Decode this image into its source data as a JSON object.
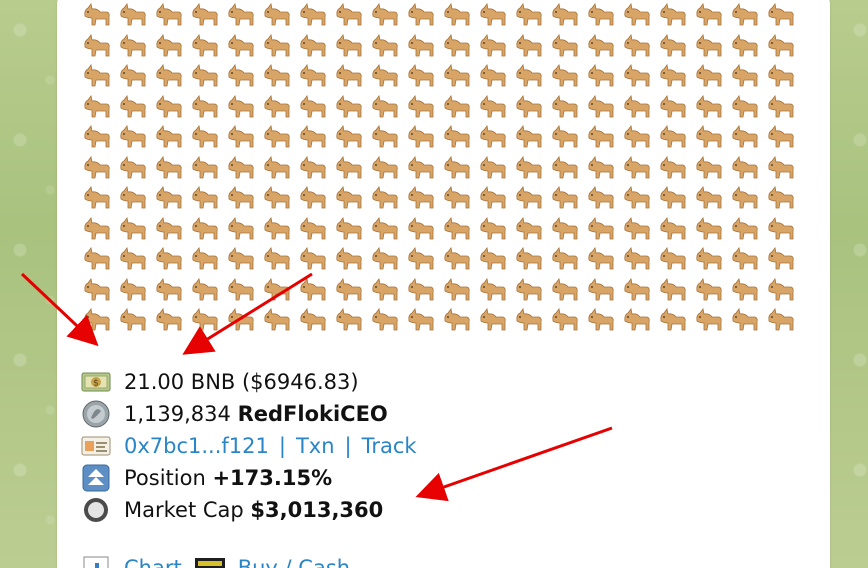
{
  "pattern": {
    "glyph": "🐕",
    "rows": 11,
    "cols": 20
  },
  "post": {
    "bnb_line": "21.00 BNB ($6946.83)",
    "tokens_amount": "1,139,834",
    "token_name": "RedFlokiCEO",
    "wallet_link": "0x7bc1...f121",
    "separator": "|",
    "txn_link": "Txn",
    "track_link": "Track",
    "position_label": "Position",
    "position_value": "+173.15%",
    "mcap_label": "Market Cap",
    "mcap_value": "$3,013,360",
    "chart_link": "Chart",
    "buy_link": "Buy / Cash"
  },
  "colors": {
    "link": "#2a85c7",
    "arrow": "#e60000"
  },
  "icons": {
    "money": "money-bill-icon",
    "coin": "coin-icon",
    "card": "id-card-icon",
    "position": "up-arrow-icon",
    "mcap": "circle-icon"
  }
}
